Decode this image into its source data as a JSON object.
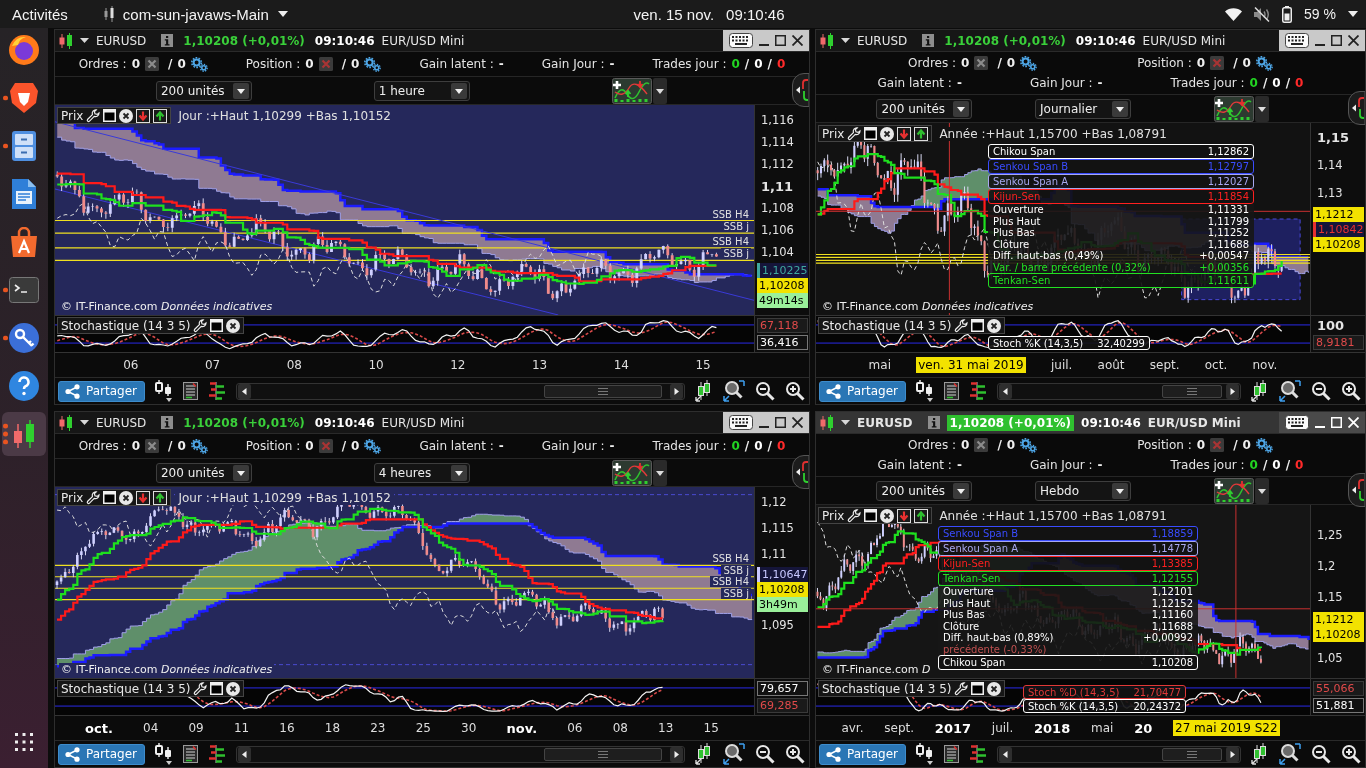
{
  "top_bar": {
    "activities": "Activités",
    "app_name": "com-sun-javaws-Main",
    "date": "ven. 15 nov.",
    "time": "09:10:46",
    "battery": "59 %",
    "volume_muted": true
  },
  "dock": {
    "items": [
      {
        "kind": "firefox",
        "running": false,
        "selected": false
      },
      {
        "kind": "brave",
        "running": true,
        "multi_window": false,
        "selected": false
      },
      {
        "kind": "files",
        "running": true,
        "multi_window": false,
        "selected": false
      },
      {
        "kind": "writer",
        "running": false,
        "selected": false
      },
      {
        "kind": "software",
        "running": false,
        "selected": false
      },
      {
        "kind": "terminal",
        "running": true,
        "multi_window": false,
        "selected": false
      },
      {
        "kind": "passwords",
        "running": true,
        "multi_window": false,
        "selected": false
      },
      {
        "kind": "help",
        "running": false,
        "selected": false
      },
      {
        "kind": "trading",
        "running": true,
        "multi_window": true,
        "selected": true
      }
    ]
  },
  "panels": [
    {
      "focused": false,
      "symbol": "EURUSD",
      "price": "1,10208 (+0,01%)",
      "price_flash": false,
      "time": "09:10:46",
      "instrument": "EUR/USD Mini",
      "stats_rows": [
        [
          {
            "kind": "orders",
            "label": "Ordres :",
            "first": "0",
            "separator": "/",
            "second": "0"
          },
          {
            "kind": "position",
            "label": "Position :",
            "first": "0",
            "separator": "/",
            "second": "0"
          },
          {
            "kind": "value",
            "label": "Gain latent :",
            "value": "-"
          },
          {
            "kind": "value",
            "label": "Gain Jour :",
            "value": "-"
          },
          {
            "kind": "trades",
            "label": "Trades jour :",
            "values": [
              {
                "text": "0",
                "color": "#22d422"
              },
              {
                "text": "0",
                "color": "#ffffff"
              },
              {
                "text": "0",
                "color": "#ff2a2a"
              }
            ],
            "separators": [
              "/",
              "/"
            ]
          }
        ]
      ],
      "quantity": "200 unités",
      "period": "1 heure",
      "price_pane": {
        "label": "Prix",
        "range": "Jour :+Haut 1,10299 +Bas 1,10152",
        "level_labels": [
          "SSB H4",
          "SSB j",
          "SSB H4",
          "SSB j"
        ],
        "credit": "© IT-Finance.com *Données indicatives*",
        "y_axis": [
          {
            "kind": "tick",
            "text": "1,116"
          },
          {
            "kind": "tick",
            "text": "1,114"
          },
          {
            "kind": "tick",
            "text": "1,112"
          },
          {
            "kind": "tick_major",
            "text": "1,11"
          },
          {
            "kind": "tick",
            "text": "1,108"
          },
          {
            "kind": "tick",
            "text": "1,106"
          },
          {
            "kind": "tick",
            "text": "1,104"
          },
          {
            "kind": "marker",
            "text": "1,10225",
            "color": "#3fa8a0"
          },
          {
            "kind": "last_price",
            "text": "1,10208"
          },
          {
            "kind": "countdown",
            "text": "49m14s"
          }
        ]
      },
      "stoch_pane": {
        "label": "Stochastique (14 3 5)",
        "y_axis": [
          {
            "kind": "d_value",
            "text": "67,118"
          },
          {
            "kind": "k_value",
            "text": "36,416"
          }
        ]
      },
      "x_axis": [
        {
          "kind": "tick",
          "text": "06"
        },
        {
          "kind": "tick",
          "text": "07"
        },
        {
          "kind": "tick",
          "text": "08"
        },
        {
          "kind": "tick",
          "text": "10"
        },
        {
          "kind": "tick",
          "text": "12"
        },
        {
          "kind": "tick",
          "text": "13"
        },
        {
          "kind": "tick",
          "text": "14"
        },
        {
          "kind": "tick",
          "text": "15"
        }
      ],
      "share": "Partager"
    },
    {
      "focused": false,
      "symbol": "EURUSD",
      "price": "1,10208 (+0,01%)",
      "price_flash": false,
      "time": "09:10:46",
      "instrument": "EUR/USD Mini",
      "stats_rows": [
        [
          {
            "kind": "orders",
            "label": "Ordres :",
            "first": "0",
            "separator": "/",
            "second": "0"
          },
          {
            "kind": "position",
            "label": "Position :",
            "first": "0",
            "separator": "/",
            "second": "0"
          }
        ],
        [
          {
            "kind": "value",
            "label": "Gain latent :",
            "value": "-"
          },
          {
            "kind": "value",
            "label": "Gain Jour :",
            "value": "-"
          },
          {
            "kind": "trades",
            "label": "Trades jour :",
            "values": [
              {
                "text": "0",
                "color": "#22d422"
              },
              {
                "text": "0",
                "color": "#ffffff"
              },
              {
                "text": "0",
                "color": "#ff2a2a"
              }
            ],
            "separators": [
              "/",
              "/"
            ]
          }
        ]
      ],
      "quantity": "200 unités",
      "period": "Journalier",
      "price_pane": {
        "label": "Prix",
        "range": "Année :+Haut 1,15700 +Bas 1,08791",
        "credit": "© IT-Finance.com *Données indicatives*",
        "y_axis": [
          {
            "kind": "tick_major",
            "text": "1,15"
          },
          {
            "kind": "tick",
            "text": "1,14"
          },
          {
            "kind": "tick",
            "text": "1,13"
          },
          {
            "kind": "cursor",
            "text": "1,1212"
          },
          {
            "kind": "marker",
            "text": "1,10842",
            "color": "#e83030"
          },
          {
            "kind": "last_price",
            "text": "1,10208"
          }
        ],
        "tooltip": [
          {
            "kind": "box",
            "label": "Chikou Span",
            "value": "1,12862",
            "color": "#ffffff"
          },
          {
            "kind": "box",
            "label": "Senkou Span B",
            "value": "1,12797",
            "color": "#3a4cff"
          },
          {
            "kind": "box",
            "label": "Senkou Span A",
            "value": "1,12027",
            "color": "#a8a8f0"
          },
          {
            "kind": "box",
            "label": "Kijun-Sen",
            "value": "1,11854",
            "color": "#ff2020"
          },
          {
            "kind": "row",
            "label": "Ouverture",
            "value": "1,11331",
            "color": "#ffffff"
          },
          {
            "kind": "row",
            "label": "Plus Haut",
            "value": "1,11799",
            "color": "#ffffff"
          },
          {
            "kind": "row",
            "label": "Plus Bas",
            "value": "1,11252",
            "color": "#ffffff"
          },
          {
            "kind": "row",
            "label": "Clôture",
            "value": "1,11688",
            "color": "#ffffff"
          },
          {
            "kind": "row",
            "label": "Diff. haut-bas (0,49%)",
            "value": "+0,00547",
            "color": "#ffffff"
          },
          {
            "kind": "row",
            "label": "Var. / barre précédente (0,32%)",
            "value": "+0,00356",
            "color": "#22e022"
          },
          {
            "kind": "box",
            "label": "Tenkan-Sen",
            "value": "1,11611",
            "color": "#22e022"
          }
        ]
      },
      "stoch_pane": {
        "label": "Stochastique (14 3 5)",
        "y_axis": [
          {
            "kind": "tick_major",
            "text": "100"
          },
          {
            "kind": "d_value",
            "text": "8,9181"
          }
        ],
        "tooltip": [
          {
            "label": "Stoch %K (14,3,5)",
            "value": "32,40299",
            "color": "#ffffff"
          }
        ]
      },
      "x_axis": [
        {
          "kind": "tick",
          "text": "mai"
        },
        {
          "kind": "cursor",
          "text": "ven. 31 mai 2019"
        },
        {
          "kind": "tick",
          "text": "juil."
        },
        {
          "kind": "tick",
          "text": "août"
        },
        {
          "kind": "tick",
          "text": "sept."
        },
        {
          "kind": "tick",
          "text": "oct."
        },
        {
          "kind": "tick",
          "text": "nov."
        }
      ],
      "share": "Partager"
    },
    {
      "focused": false,
      "symbol": "EURUSD",
      "price": "1,10208 (+0,01%)",
      "price_flash": false,
      "time": "09:10:46",
      "instrument": "EUR/USD Mini",
      "stats_rows": [
        [
          {
            "kind": "orders",
            "label": "Ordres :",
            "first": "0",
            "separator": "/",
            "second": "0"
          },
          {
            "kind": "position",
            "label": "Position :",
            "first": "0",
            "separator": "/",
            "second": "0"
          },
          {
            "kind": "value",
            "label": "Gain latent :",
            "value": "-"
          },
          {
            "kind": "value",
            "label": "Gain Jour :",
            "value": "-"
          },
          {
            "kind": "trades",
            "label": "Trades jour :",
            "values": [
              {
                "text": "0",
                "color": "#22d422"
              },
              {
                "text": "0",
                "color": "#ffffff"
              },
              {
                "text": "0",
                "color": "#ff2a2a"
              }
            ],
            "separators": [
              "/",
              "/"
            ]
          }
        ]
      ],
      "quantity": "200 unités",
      "period": "4 heures",
      "price_pane": {
        "label": "Prix",
        "range": "Jour :+Haut 1,10299 +Bas 1,10152",
        "level_labels": [
          "SSB H4",
          "SSB j",
          "SSB H4",
          "SSB j"
        ],
        "credit": "© IT-Finance.com *Données indicatives*",
        "y_axis": [
          {
            "kind": "tick",
            "text": "1,12"
          },
          {
            "kind": "tick",
            "text": "1,115"
          },
          {
            "kind": "tick",
            "text": "1,11"
          },
          {
            "kind": "marker",
            "text": "1,10647",
            "color": "#c8c8ff"
          },
          {
            "kind": "last_price",
            "text": "1,10208"
          },
          {
            "kind": "countdown",
            "text": "3h49m"
          },
          {
            "kind": "tick",
            "text": "1,095"
          }
        ]
      },
      "stoch_pane": {
        "label": "Stochastique (14 3 5)",
        "y_axis": [
          {
            "kind": "k_value",
            "text": "79,657"
          },
          {
            "kind": "d_value",
            "text": "69,285"
          }
        ]
      },
      "x_axis": [
        {
          "kind": "tick_major",
          "text": "oct."
        },
        {
          "kind": "tick",
          "text": "04"
        },
        {
          "kind": "tick",
          "text": "09"
        },
        {
          "kind": "tick",
          "text": "11"
        },
        {
          "kind": "tick",
          "text": "16"
        },
        {
          "kind": "tick",
          "text": "18"
        },
        {
          "kind": "tick",
          "text": "23"
        },
        {
          "kind": "tick",
          "text": "25"
        },
        {
          "kind": "tick",
          "text": "30"
        },
        {
          "kind": "tick_major",
          "text": "nov."
        },
        {
          "kind": "tick",
          "text": "06"
        },
        {
          "kind": "tick",
          "text": "08"
        },
        {
          "kind": "tick",
          "text": "13"
        },
        {
          "kind": "tick",
          "text": "15"
        }
      ],
      "share": "Partager"
    },
    {
      "focused": true,
      "symbol": "EURUSD",
      "price": "1,10208 (+0,01%)",
      "price_flash": true,
      "time": "09:10:46",
      "instrument": "EUR/USD Mini",
      "stats_rows": [
        [
          {
            "kind": "orders",
            "label": "Ordres :",
            "first": "0",
            "separator": "/",
            "second": "0"
          },
          {
            "kind": "position",
            "label": "Position :",
            "first": "0",
            "separator": "/",
            "second": "0"
          }
        ],
        [
          {
            "kind": "value",
            "label": "Gain latent :",
            "value": "-"
          },
          {
            "kind": "value",
            "label": "Gain Jour :",
            "value": "-"
          },
          {
            "kind": "trades",
            "label": "Trades jour :",
            "values": [
              {
                "text": "0",
                "color": "#22d422"
              },
              {
                "text": "0",
                "color": "#ffffff"
              },
              {
                "text": "0",
                "color": "#ff2a2a"
              }
            ],
            "separators": [
              "/",
              "/"
            ]
          }
        ]
      ],
      "quantity": "200 unités",
      "period": "Hebdo",
      "price_pane": {
        "label": "Prix",
        "range": "Année :+Haut 1,15700 +Bas 1,08791",
        "credit": "© IT-Finance.com *D*",
        "y_axis": [
          {
            "kind": "tick",
            "text": "1,25"
          },
          {
            "kind": "tick",
            "text": "1,2"
          },
          {
            "kind": "tick",
            "text": "1,15"
          },
          {
            "kind": "cursor",
            "text": "1,1212"
          },
          {
            "kind": "last_price",
            "text": "1,10208"
          },
          {
            "kind": "tick",
            "text": "1,05"
          }
        ],
        "tooltip": [
          {
            "kind": "box",
            "label": "Senkou Span B",
            "value": "1,18859",
            "color": "#3a4cff"
          },
          {
            "kind": "box",
            "label": "Senkou Span A",
            "value": "1,14778",
            "color": "#a8a8f0"
          },
          {
            "kind": "box",
            "label": "Kijun-Sen",
            "value": "1,13385",
            "color": "#ff2020"
          },
          {
            "kind": "box",
            "label": "Tenkan-Sen",
            "value": "1,12155",
            "color": "#22e022"
          },
          {
            "kind": "row",
            "label": "Ouverture",
            "value": "1,12101",
            "color": "#ffffff"
          },
          {
            "kind": "row",
            "label": "Plus Haut",
            "value": "1,12152",
            "color": "#ffffff"
          },
          {
            "kind": "row",
            "label": "Plus Bas",
            "value": "1,11160",
            "color": "#ffffff"
          },
          {
            "kind": "row",
            "label": "Clôture",
            "value": "1,11688",
            "color": "#ffffff"
          },
          {
            "kind": "row",
            "label": "Diff. haut-bas (0,89%)",
            "value": "+0,00992",
            "color": "#ffffff"
          },
          {
            "kind": "row",
            "label": "précédente (-0,33%)",
            "color": "#c05050"
          },
          {
            "kind": "box",
            "label": "Chikou Span",
            "value": "1,10208",
            "color": "#ffffff"
          }
        ]
      },
      "stoch_pane": {
        "label": "Stochastique (14 3 5)",
        "y_axis": [
          {
            "kind": "d_value",
            "text": "55,066"
          },
          {
            "kind": "k_value",
            "text": "51,881"
          }
        ],
        "tooltip": [
          {
            "label": "Stoch %D (14,3,5)",
            "value": "21,70477",
            "color": "#e03838"
          },
          {
            "label": "Stoch %K (14,3,5)",
            "value": "20,24372",
            "color": "#ffffff"
          }
        ]
      },
      "x_axis": [
        {
          "kind": "tick",
          "text": "avr."
        },
        {
          "kind": "tick",
          "text": "sept."
        },
        {
          "kind": "tick_major",
          "text": "2017"
        },
        {
          "kind": "tick",
          "text": "juil."
        },
        {
          "kind": "tick_major",
          "text": "2018"
        },
        {
          "kind": "tick",
          "text": "mai"
        },
        {
          "kind": "tick_major",
          "text": "20"
        },
        {
          "kind": "cursor",
          "text": "27 mai 2019 S22"
        }
      ],
      "share": "Partager"
    }
  ]
}
